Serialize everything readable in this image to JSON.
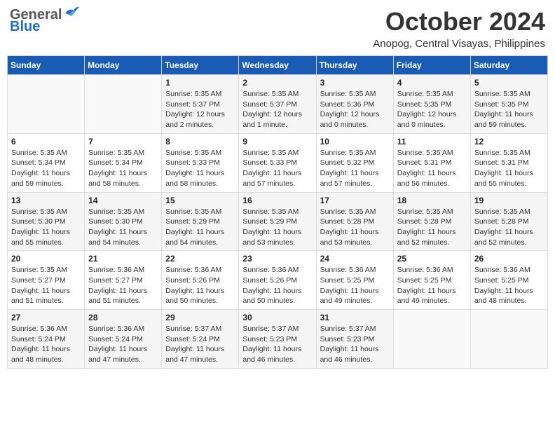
{
  "header": {
    "logo_general": "General",
    "logo_blue": "Blue",
    "month_year": "October 2024",
    "location": "Anopog, Central Visayas, Philippines"
  },
  "weekdays": [
    "Sunday",
    "Monday",
    "Tuesday",
    "Wednesday",
    "Thursday",
    "Friday",
    "Saturday"
  ],
  "weeks": [
    [
      {
        "day": "",
        "detail": ""
      },
      {
        "day": "",
        "detail": ""
      },
      {
        "day": "1",
        "detail": "Sunrise: 5:35 AM\nSunset: 5:37 PM\nDaylight: 12 hours\nand 2 minutes."
      },
      {
        "day": "2",
        "detail": "Sunrise: 5:35 AM\nSunset: 5:37 PM\nDaylight: 12 hours\nand 1 minute."
      },
      {
        "day": "3",
        "detail": "Sunrise: 5:35 AM\nSunset: 5:36 PM\nDaylight: 12 hours\nand 0 minutes."
      },
      {
        "day": "4",
        "detail": "Sunrise: 5:35 AM\nSunset: 5:35 PM\nDaylight: 12 hours\nand 0 minutes."
      },
      {
        "day": "5",
        "detail": "Sunrise: 5:35 AM\nSunset: 5:35 PM\nDaylight: 11 hours\nand 59 minutes."
      }
    ],
    [
      {
        "day": "6",
        "detail": "Sunrise: 5:35 AM\nSunset: 5:34 PM\nDaylight: 11 hours\nand 59 minutes."
      },
      {
        "day": "7",
        "detail": "Sunrise: 5:35 AM\nSunset: 5:34 PM\nDaylight: 11 hours\nand 58 minutes."
      },
      {
        "day": "8",
        "detail": "Sunrise: 5:35 AM\nSunset: 5:33 PM\nDaylight: 11 hours\nand 58 minutes."
      },
      {
        "day": "9",
        "detail": "Sunrise: 5:35 AM\nSunset: 5:33 PM\nDaylight: 11 hours\nand 57 minutes."
      },
      {
        "day": "10",
        "detail": "Sunrise: 5:35 AM\nSunset: 5:32 PM\nDaylight: 11 hours\nand 57 minutes."
      },
      {
        "day": "11",
        "detail": "Sunrise: 5:35 AM\nSunset: 5:31 PM\nDaylight: 11 hours\nand 56 minutes."
      },
      {
        "day": "12",
        "detail": "Sunrise: 5:35 AM\nSunset: 5:31 PM\nDaylight: 11 hours\nand 55 minutes."
      }
    ],
    [
      {
        "day": "13",
        "detail": "Sunrise: 5:35 AM\nSunset: 5:30 PM\nDaylight: 11 hours\nand 55 minutes."
      },
      {
        "day": "14",
        "detail": "Sunrise: 5:35 AM\nSunset: 5:30 PM\nDaylight: 11 hours\nand 54 minutes."
      },
      {
        "day": "15",
        "detail": "Sunrise: 5:35 AM\nSunset: 5:29 PM\nDaylight: 11 hours\nand 54 minutes."
      },
      {
        "day": "16",
        "detail": "Sunrise: 5:35 AM\nSunset: 5:29 PM\nDaylight: 11 hours\nand 53 minutes."
      },
      {
        "day": "17",
        "detail": "Sunrise: 5:35 AM\nSunset: 5:28 PM\nDaylight: 11 hours\nand 53 minutes."
      },
      {
        "day": "18",
        "detail": "Sunrise: 5:35 AM\nSunset: 5:28 PM\nDaylight: 11 hours\nand 52 minutes."
      },
      {
        "day": "19",
        "detail": "Sunrise: 5:35 AM\nSunset: 5:28 PM\nDaylight: 11 hours\nand 52 minutes."
      }
    ],
    [
      {
        "day": "20",
        "detail": "Sunrise: 5:35 AM\nSunset: 5:27 PM\nDaylight: 11 hours\nand 51 minutes."
      },
      {
        "day": "21",
        "detail": "Sunrise: 5:36 AM\nSunset: 5:27 PM\nDaylight: 11 hours\nand 51 minutes."
      },
      {
        "day": "22",
        "detail": "Sunrise: 5:36 AM\nSunset: 5:26 PM\nDaylight: 11 hours\nand 50 minutes."
      },
      {
        "day": "23",
        "detail": "Sunrise: 5:36 AM\nSunset: 5:26 PM\nDaylight: 11 hours\nand 50 minutes."
      },
      {
        "day": "24",
        "detail": "Sunrise: 5:36 AM\nSunset: 5:25 PM\nDaylight: 11 hours\nand 49 minutes."
      },
      {
        "day": "25",
        "detail": "Sunrise: 5:36 AM\nSunset: 5:25 PM\nDaylight: 11 hours\nand 49 minutes."
      },
      {
        "day": "26",
        "detail": "Sunrise: 5:36 AM\nSunset: 5:25 PM\nDaylight: 11 hours\nand 48 minutes."
      }
    ],
    [
      {
        "day": "27",
        "detail": "Sunrise: 5:36 AM\nSunset: 5:24 PM\nDaylight: 11 hours\nand 48 minutes."
      },
      {
        "day": "28",
        "detail": "Sunrise: 5:36 AM\nSunset: 5:24 PM\nDaylight: 11 hours\nand 47 minutes."
      },
      {
        "day": "29",
        "detail": "Sunrise: 5:37 AM\nSunset: 5:24 PM\nDaylight: 11 hours\nand 47 minutes."
      },
      {
        "day": "30",
        "detail": "Sunrise: 5:37 AM\nSunset: 5:23 PM\nDaylight: 11 hours\nand 46 minutes."
      },
      {
        "day": "31",
        "detail": "Sunrise: 5:37 AM\nSunset: 5:23 PM\nDaylight: 11 hours\nand 46 minutes."
      },
      {
        "day": "",
        "detail": ""
      },
      {
        "day": "",
        "detail": ""
      }
    ]
  ]
}
